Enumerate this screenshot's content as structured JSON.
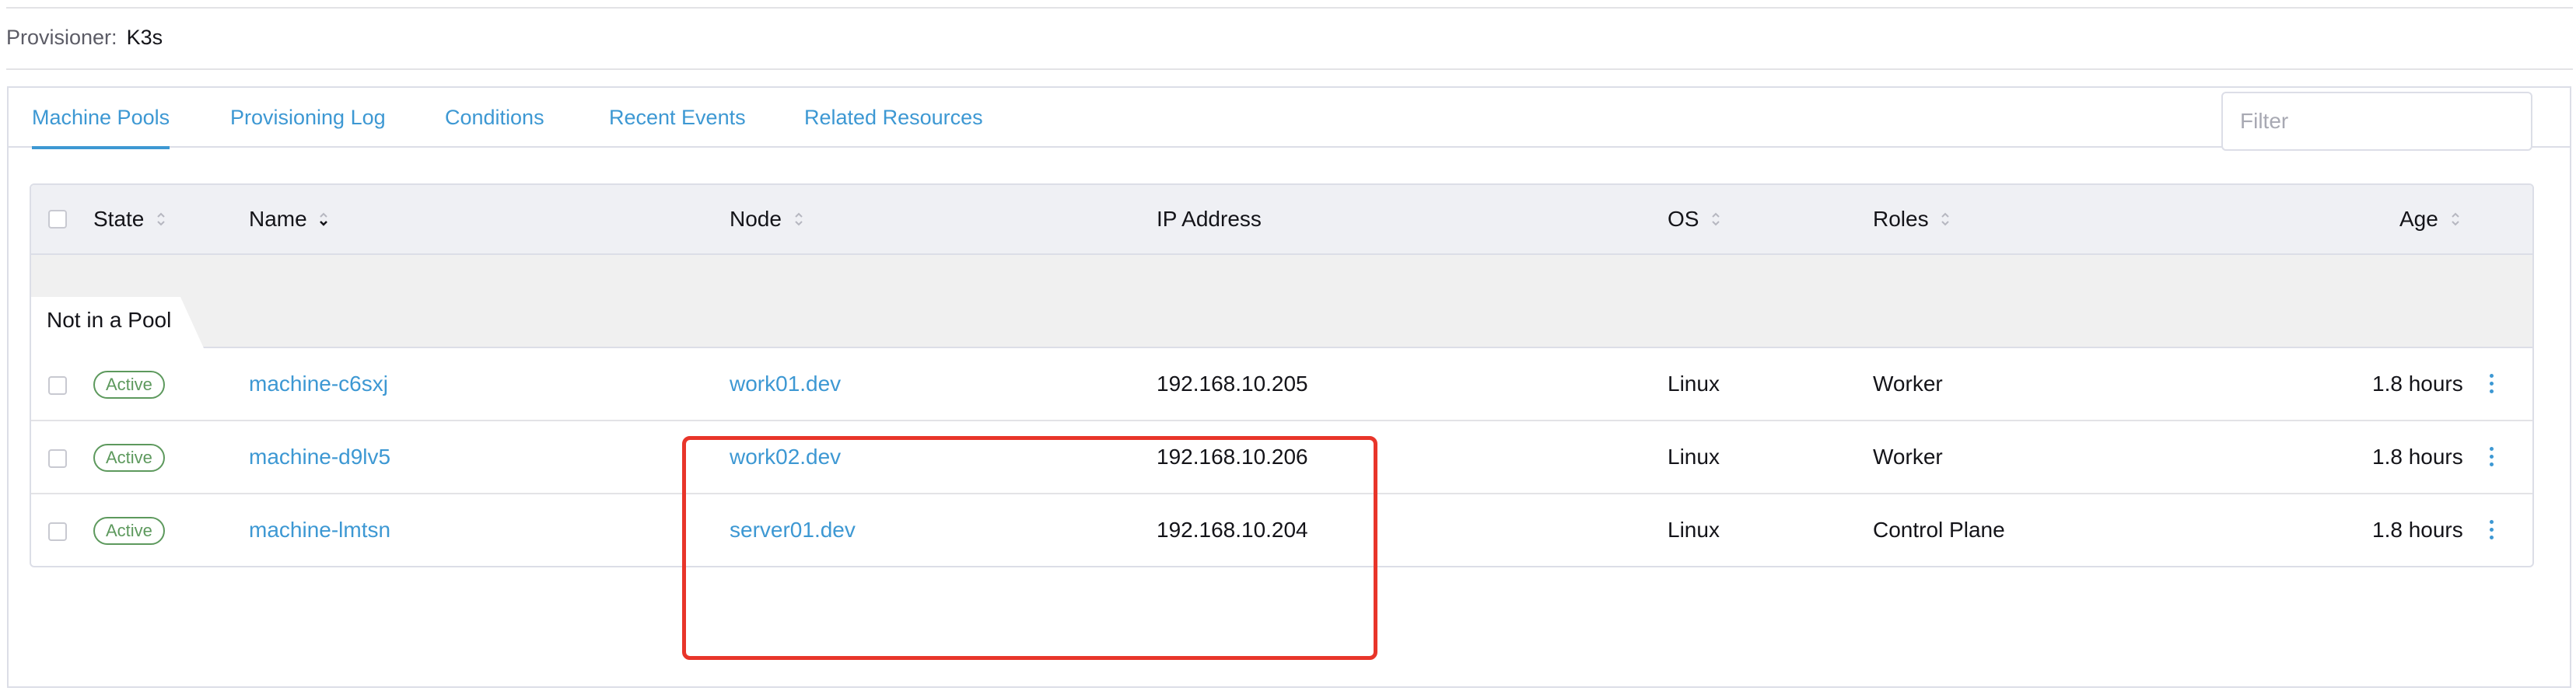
{
  "header": {
    "provisioner_label": "Provisioner:",
    "provisioner_value": "K3s"
  },
  "tabs": [
    {
      "label": "Machine Pools",
      "active": true
    },
    {
      "label": "Provisioning Log",
      "active": false
    },
    {
      "label": "Conditions",
      "active": false
    },
    {
      "label": "Recent Events",
      "active": false
    },
    {
      "label": "Related Resources",
      "active": false
    }
  ],
  "filter": {
    "placeholder": "Filter",
    "value": ""
  },
  "table": {
    "columns": {
      "state": "State",
      "name": "Name",
      "node": "Node",
      "ip": "IP Address",
      "os": "OS",
      "roles": "Roles",
      "age": "Age"
    },
    "group": {
      "label": "Not in a Pool"
    },
    "rows": [
      {
        "state": "Active",
        "name": "machine-c6sxj",
        "node": "work01.dev",
        "ip": "192.168.10.205",
        "os": "Linux",
        "roles": "Worker",
        "age": "1.8 hours"
      },
      {
        "state": "Active",
        "name": "machine-d9lv5",
        "node": "work02.dev",
        "ip": "192.168.10.206",
        "os": "Linux",
        "roles": "Worker",
        "age": "1.8 hours"
      },
      {
        "state": "Active",
        "name": "machine-lmtsn",
        "node": "server01.dev",
        "ip": "192.168.10.204",
        "os": "Linux",
        "roles": "Control Plane",
        "age": "1.8 hours"
      }
    ]
  },
  "icons": {
    "sort": "sort-updown-icon",
    "sort_active": "sort-down-icon",
    "row_actions": "kebab-menu-icon"
  },
  "colors": {
    "link": "#3d98d3",
    "active_badge": "#5d995d",
    "highlight": "#e8352a",
    "header_bg": "#eff0f4"
  }
}
